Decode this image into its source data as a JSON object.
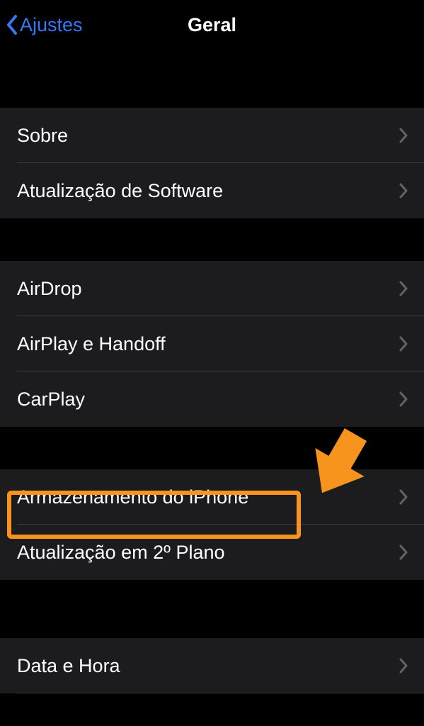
{
  "header": {
    "back_label": "Ajustes",
    "title": "Geral"
  },
  "groups": [
    {
      "rows": [
        {
          "label": "Sobre"
        },
        {
          "label": "Atualização de Software"
        }
      ]
    },
    {
      "rows": [
        {
          "label": "AirDrop"
        },
        {
          "label": "AirPlay e Handoff"
        },
        {
          "label": "CarPlay"
        }
      ]
    },
    {
      "rows": [
        {
          "label": "Armazenamento do iPhone"
        },
        {
          "label": "Atualização em 2º Plano"
        }
      ]
    },
    {
      "rows": [
        {
          "label": "Data e Hora"
        }
      ]
    }
  ],
  "annotation": {
    "highlight_color": "#f7941e",
    "arrow_color": "#f7941e"
  }
}
